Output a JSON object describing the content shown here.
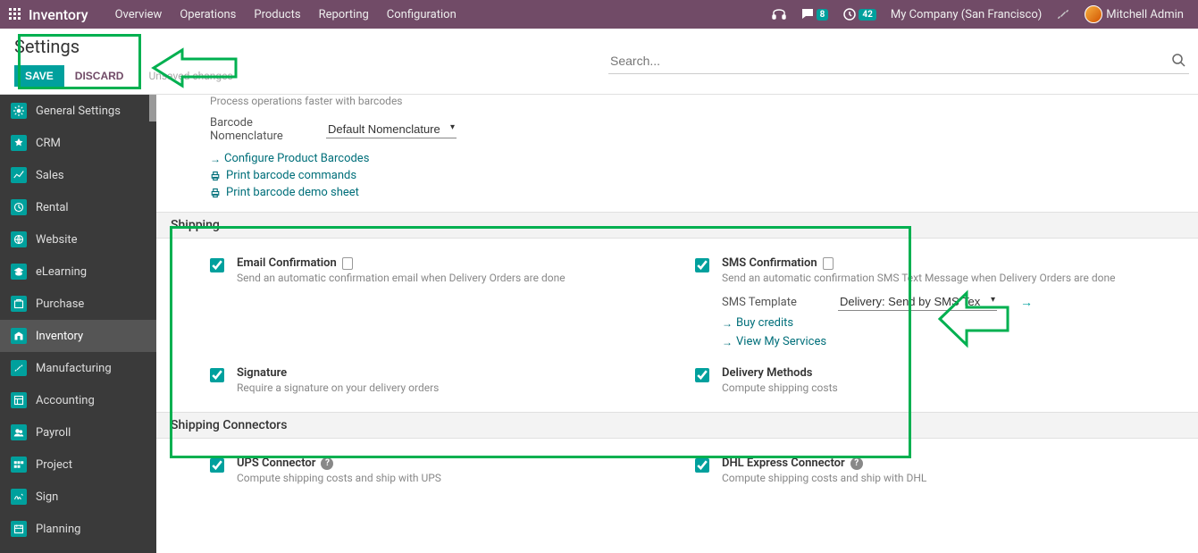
{
  "topbar": {
    "app_name": "Inventory",
    "menu": [
      "Overview",
      "Operations",
      "Products",
      "Reporting",
      "Configuration"
    ],
    "messages_badge": "8",
    "activities_badge": "42",
    "company": "My Company (San Francisco)",
    "user": "Mitchell Admin"
  },
  "header": {
    "title": "Settings",
    "save": "SAVE",
    "discard": "DISCARD",
    "unsaved": "Unsaved changes",
    "search_placeholder": "Search..."
  },
  "sidebar": {
    "items": [
      {
        "label": "General Settings"
      },
      {
        "label": "CRM"
      },
      {
        "label": "Sales"
      },
      {
        "label": "Rental"
      },
      {
        "label": "Website"
      },
      {
        "label": "eLearning"
      },
      {
        "label": "Purchase"
      },
      {
        "label": "Inventory",
        "active": true
      },
      {
        "label": "Manufacturing"
      },
      {
        "label": "Accounting"
      },
      {
        "label": "Payroll"
      },
      {
        "label": "Project"
      },
      {
        "label": "Sign"
      },
      {
        "label": "Planning"
      }
    ]
  },
  "barcode_section": {
    "desc": "Process operations faster with barcodes",
    "nom_label": "Barcode Nomenclature",
    "nom_value": "Default Nomenclature",
    "link_configure": "Configure Product Barcodes",
    "link_print_cmd": "Print barcode commands",
    "link_print_demo": "Print barcode demo sheet"
  },
  "shipping_section": {
    "header": "Shipping",
    "email": {
      "title": "Email Confirmation",
      "desc": "Send an automatic confirmation email when Delivery Orders are done"
    },
    "sms": {
      "title": "SMS Confirmation",
      "desc": "Send an automatic confirmation SMS Text Message when Delivery Orders are done",
      "template_label": "SMS Template",
      "template_value": "Delivery: Send by SMS Tex",
      "buy_credits": "Buy credits",
      "view_services": "View My Services"
    },
    "signature": {
      "title": "Signature",
      "desc": "Require a signature on your delivery orders"
    },
    "delivery": {
      "title": "Delivery Methods",
      "desc": "Compute shipping costs"
    }
  },
  "connectors_section": {
    "header": "Shipping Connectors",
    "ups": {
      "title": "UPS Connector",
      "desc": "Compute shipping costs and ship with UPS"
    },
    "dhl": {
      "title": "DHL Express Connector",
      "desc": "Compute shipping costs and ship with DHL"
    }
  }
}
